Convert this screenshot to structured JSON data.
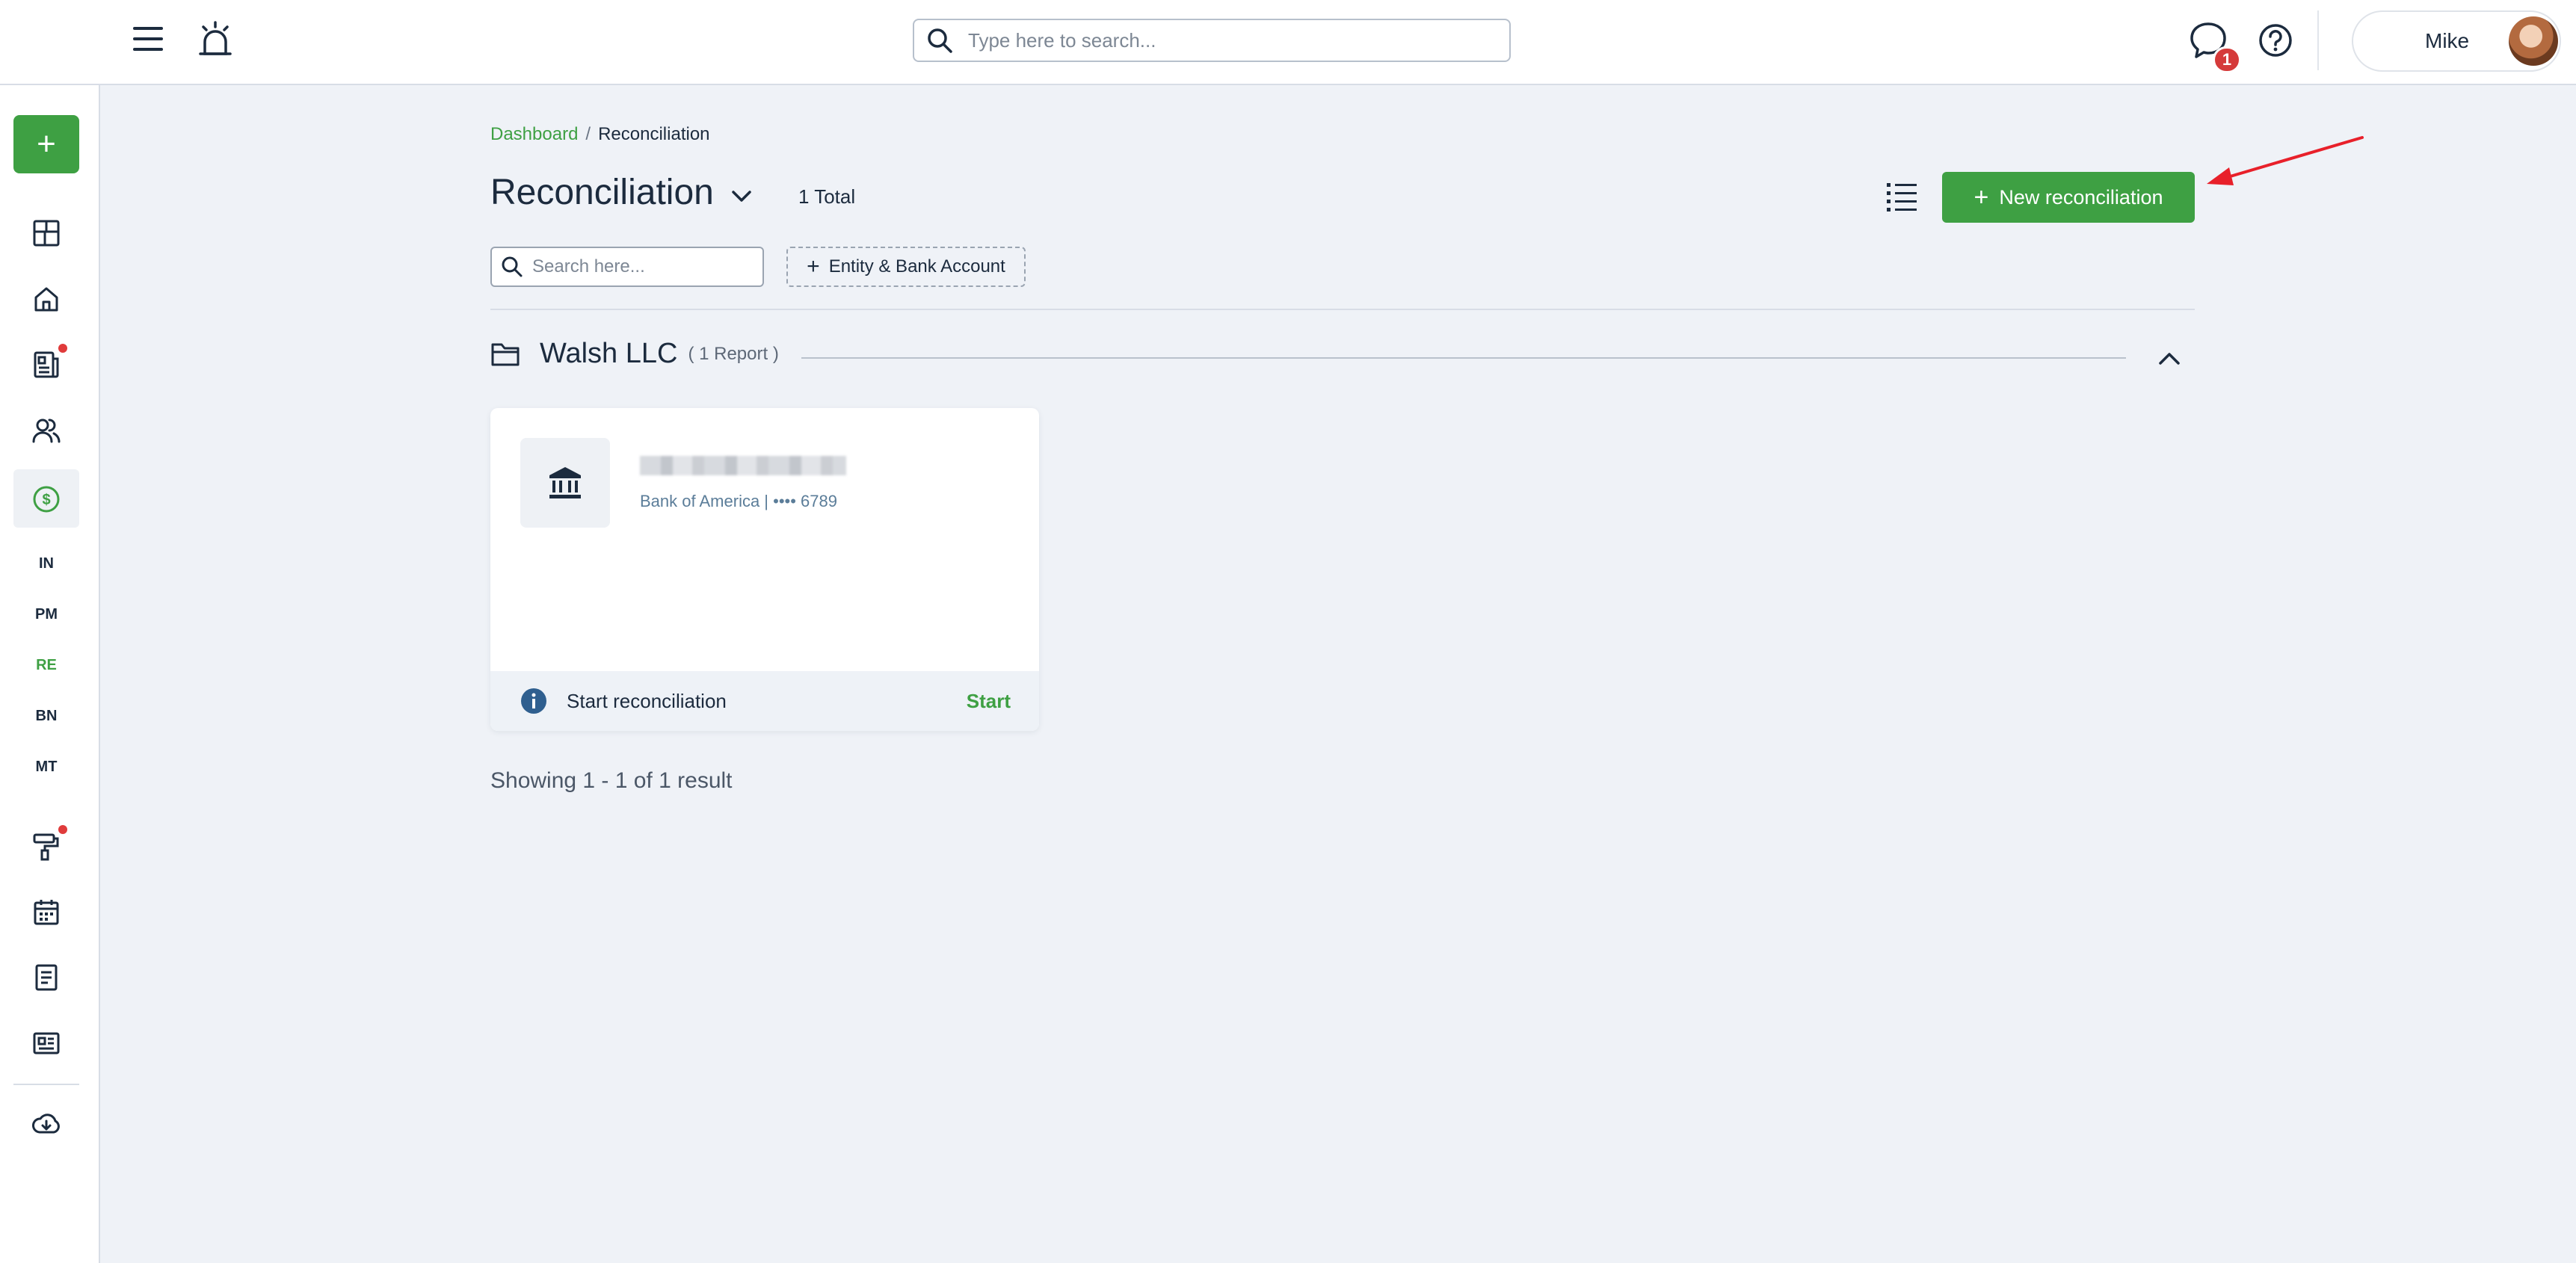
{
  "topbar": {
    "search_placeholder": "Type here to search...",
    "chat_badge_count": "1",
    "user_name": "Mike"
  },
  "sidebar": {
    "add_label": "+",
    "text_items": [
      {
        "label": "IN"
      },
      {
        "label": "PM"
      },
      {
        "label": "RE"
      },
      {
        "label": "BN"
      },
      {
        "label": "MT"
      }
    ],
    "active_item": "RE",
    "accent_color": "#3ea043",
    "notification_dot_color": "#e03b3b"
  },
  "breadcrumb": {
    "link": "Dashboard",
    "separator": "/",
    "current": "Reconciliation"
  },
  "header": {
    "title": "Reconciliation",
    "total": "1 Total",
    "new_button_label": "New reconciliation",
    "new_button_plus": "+"
  },
  "filters": {
    "search_placeholder": "Search here...",
    "entity_filter_label": "Entity & Bank Account",
    "entity_filter_plus": "+"
  },
  "group": {
    "name": "Walsh LLC",
    "count": "( 1 Report )"
  },
  "card": {
    "account_line": "Bank of America | •••• 6789",
    "footer_text": "Start reconciliation",
    "start_label": "Start"
  },
  "pagination": {
    "showing": "Showing 1 - 1 of 1 result"
  }
}
